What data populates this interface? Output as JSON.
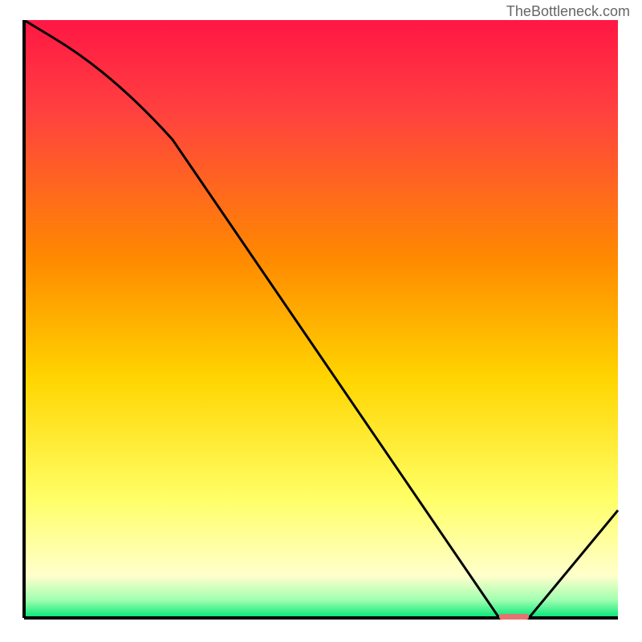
{
  "watermark": "TheBottleneck.com",
  "chart_data": {
    "type": "line",
    "title": "",
    "xlabel": "",
    "ylabel": "",
    "xlim": [
      0,
      100
    ],
    "ylim": [
      0,
      100
    ],
    "gradient_colors": {
      "top": "#ff1744",
      "upper_mid": "#ff8a00",
      "mid": "#ffd500",
      "lower_mid": "#ffff66",
      "near_bottom": "#ffffcc",
      "bottom": "#00e676"
    },
    "x": [
      0,
      5,
      25,
      80,
      85,
      100
    ],
    "y": [
      100,
      97,
      80,
      0,
      0,
      18
    ],
    "marker": {
      "x_start": 80,
      "x_end": 85,
      "y": 0,
      "color": "#e57373"
    }
  }
}
